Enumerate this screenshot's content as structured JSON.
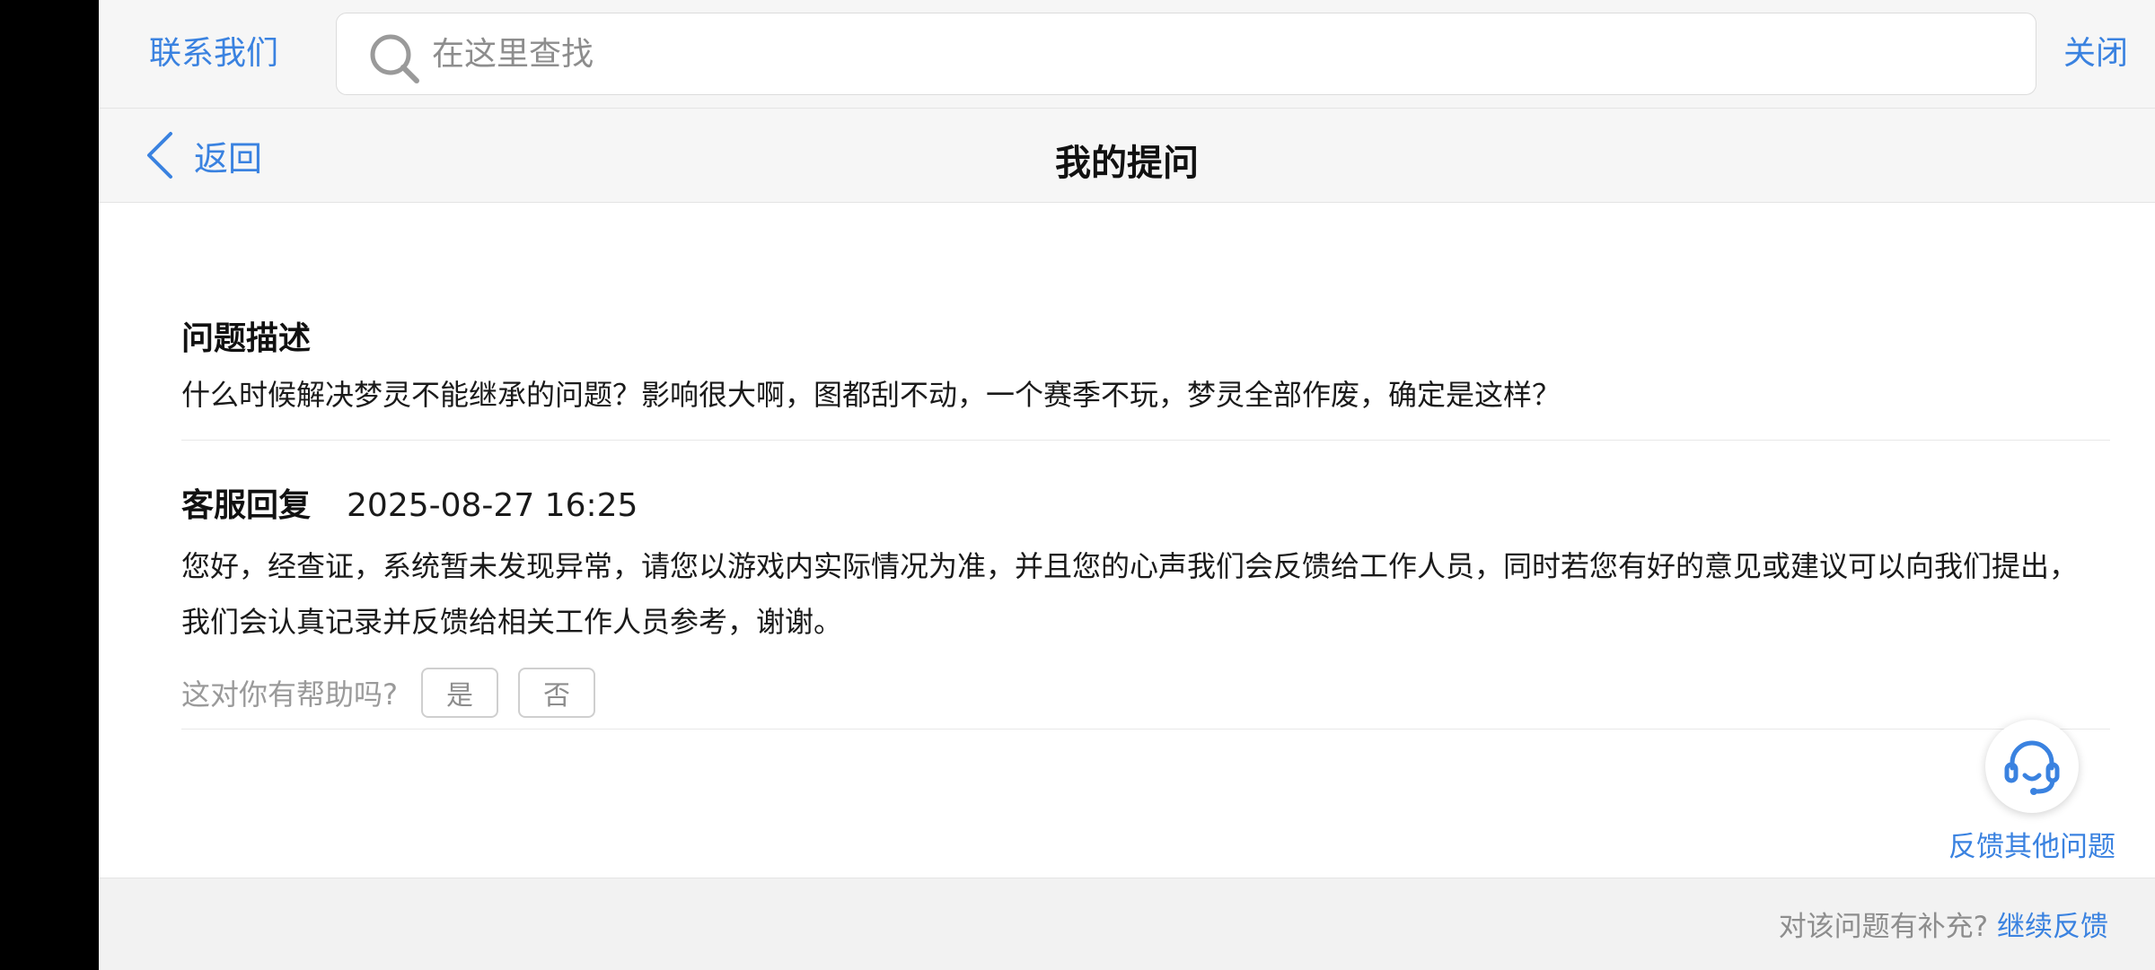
{
  "topbar": {
    "contact_label": "联系我们",
    "search_placeholder": "在这里查找",
    "close_label": "关闭"
  },
  "navbar": {
    "back_label": "返回",
    "title": "我的提问"
  },
  "question": {
    "heading": "问题描述",
    "text": "什么时候解决梦灵不能继承的问题？影响很大啊，图都刮不动，一个赛季不玩，梦灵全部作废，确定是这样？"
  },
  "reply": {
    "heading": "客服回复",
    "time": "2025-08-27 16:25",
    "text": "您好，经查证，系统暂未发现异常，请您以游戏内实际情况为准，并且您的心声我们会反馈给工作人员，同时若您有好的意见或建议可以向我们提出，我们会认真记录并反馈给相关工作人员参考，谢谢。",
    "helpful_label": "这对你有帮助吗?",
    "yes_label": "是",
    "no_label": "否"
  },
  "float_feedback": {
    "label": "反馈其他问题"
  },
  "bottom": {
    "prompt": "对该问题有补充?",
    "continue_label": "继续反馈"
  },
  "colors": {
    "accent": "#3a82e0",
    "page_bg": "#ffffff",
    "bar_bg": "#f6f6f6"
  }
}
